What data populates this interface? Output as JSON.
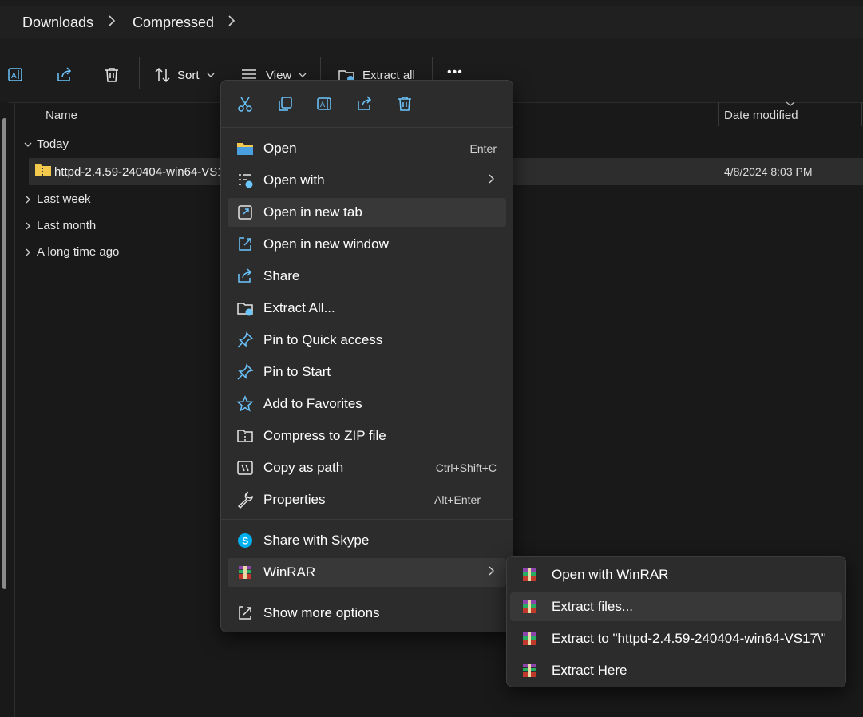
{
  "breadcrumb": {
    "items": [
      "Downloads",
      "Compressed"
    ]
  },
  "toolbar": {
    "sort_label": "Sort",
    "view_label": "View",
    "extract_all_label": "Extract all",
    "more_label": "•••"
  },
  "columns": {
    "name": "Name",
    "date_modified": "Date modified"
  },
  "groups": {
    "today": "Today",
    "last_week": "Last week",
    "last_month": "Last month",
    "long_ago": "A long time ago"
  },
  "file": {
    "name": "httpd-2.4.59-240404-win64-VS1",
    "date": "4/8/2024 8:03 PM"
  },
  "context_menu": {
    "items": [
      {
        "label": "Open",
        "shortcut": "Enter",
        "icon": "folder-icon"
      },
      {
        "label": "Open with",
        "shortcut": "",
        "icon": "open-with-icon"
      },
      {
        "label": "Open in new tab",
        "shortcut": "",
        "icon": "new-tab-icon"
      },
      {
        "label": "Open in new window",
        "shortcut": "",
        "icon": "new-window-icon"
      },
      {
        "label": "Share",
        "shortcut": "",
        "icon": "share-icon"
      },
      {
        "label": "Extract All...",
        "shortcut": "",
        "icon": "extract-icon"
      },
      {
        "label": "Pin to Quick access",
        "shortcut": "",
        "icon": "pin-icon"
      },
      {
        "label": "Pin to Start",
        "shortcut": "",
        "icon": "pin-icon"
      },
      {
        "label": "Add to Favorites",
        "shortcut": "",
        "icon": "star-icon"
      },
      {
        "label": "Compress to ZIP file",
        "shortcut": "",
        "icon": "zip-icon"
      },
      {
        "label": "Copy as path",
        "shortcut": "Ctrl+Shift+C",
        "icon": "copy-path-icon"
      },
      {
        "label": "Properties",
        "shortcut": "Alt+Enter",
        "icon": "wrench-icon"
      },
      {
        "label": "Share with Skype",
        "shortcut": "",
        "icon": "skype-icon"
      },
      {
        "label": "WinRAR",
        "shortcut": "",
        "icon": "winrar-icon"
      },
      {
        "label": "Show more options",
        "shortcut": "",
        "icon": "more-options-icon"
      }
    ]
  },
  "winrar_submenu": {
    "items": [
      {
        "label": "Open with WinRAR"
      },
      {
        "label": "Extract files..."
      },
      {
        "label": "Extract to \"httpd-2.4.59-240404-win64-VS17\\\""
      },
      {
        "label": "Extract Here"
      }
    ]
  },
  "colors": {
    "accent": "#6cc6ff",
    "menu_bg": "#2c2c2c",
    "hover": "#383838",
    "skype": "#00aff0"
  }
}
